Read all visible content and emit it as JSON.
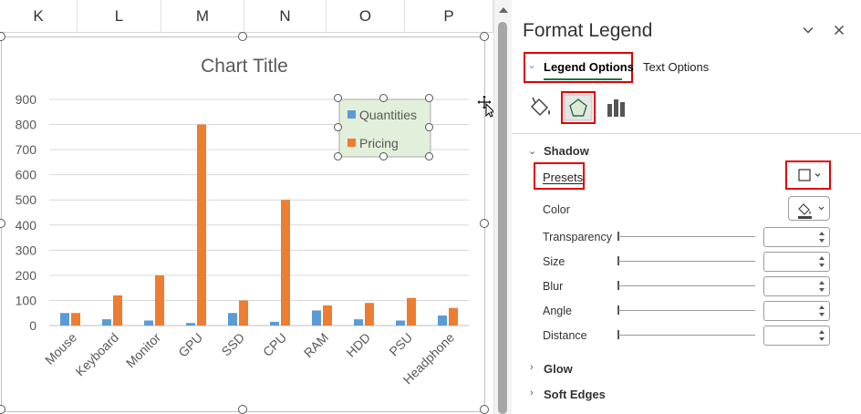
{
  "sheet": {
    "columns": [
      "K",
      "L",
      "M",
      "N",
      "O",
      "P"
    ]
  },
  "chart": {
    "title": "Chart Title",
    "legend": [
      "Quantities",
      "Pricing"
    ]
  },
  "chart_data": {
    "type": "bar",
    "title": "Chart Title",
    "categories": [
      "Mouse",
      "Keyboard",
      "Monitor",
      "GPU",
      "SSD",
      "CPU",
      "RAM",
      "HDD",
      "PSU",
      "Headphone"
    ],
    "series": [
      {
        "name": "Quantities",
        "values": [
          50,
          25,
          20,
          10,
          50,
          15,
          60,
          25,
          20,
          40
        ],
        "color": "#5b9bd5"
      },
      {
        "name": "Pricing",
        "values": [
          50,
          120,
          200,
          800,
          100,
          500,
          80,
          90,
          110,
          70
        ],
        "color": "#ed7d31"
      }
    ],
    "yticks": [
      "0",
      "100",
      "200",
      "300",
      "400",
      "500",
      "600",
      "700",
      "800",
      "900"
    ],
    "ylim": [
      0,
      900
    ],
    "grid": true,
    "legend_position": "top-right",
    "legend_fill": "#e2efda"
  },
  "pane": {
    "title": "Format Legend",
    "tabs": {
      "legend_options": "Legend Options",
      "text_options": "Text Options"
    },
    "sections": {
      "shadow": "Shadow",
      "glow": "Glow",
      "soft_edges": "Soft Edges"
    },
    "props": {
      "presets": "Presets",
      "color": "Color",
      "transparency": "Transparency",
      "size": "Size",
      "blur": "Blur",
      "angle": "Angle",
      "distance": "Distance"
    }
  },
  "icons": {
    "fill": "paint-bucket-icon",
    "effects": "pentagon-icon",
    "size": "bar-chart-icon"
  }
}
